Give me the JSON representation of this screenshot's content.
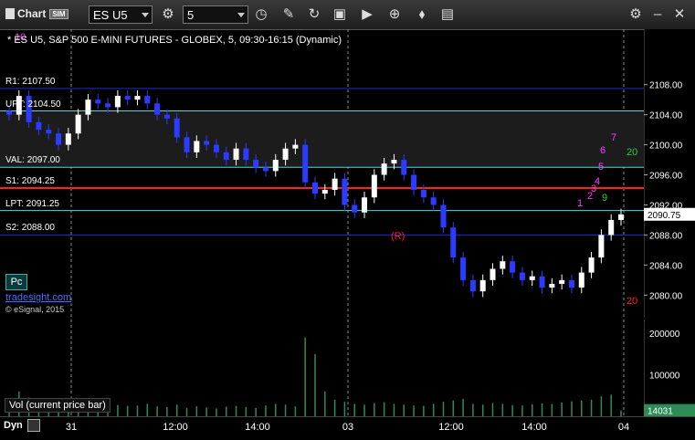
{
  "toolbar": {
    "app_name": "Chart",
    "app_badge": "SIM",
    "symbol": "ES U5",
    "interval": "5"
  },
  "chart_header": {
    "title": "* ES U5, S&P 500 E-MINI FUTURES - GLOBEX, 5, 09:30-16:15 (Dynamic)"
  },
  "levels": [
    {
      "label": "R1: 2107.50",
      "price": 2107.5,
      "color": "#1e2bd6"
    },
    {
      "label": "UPT: 2104.50",
      "price": 2104.5,
      "color": "#40e0e0"
    },
    {
      "label": "VAL: 2097.00",
      "price": 2097.0,
      "color": "#40e0e0"
    },
    {
      "label": "S1: 2094.25",
      "price": 2094.25,
      "color": "#ff2020"
    },
    {
      "label": "LPT: 2091.25",
      "price": 2091.25,
      "color": "#40e0e0"
    },
    {
      "label": "S2: 2088.00",
      "price": 2088.0,
      "color": "#1e2bd6"
    }
  ],
  "chart_data": {
    "type": "candlestick",
    "price_axis_ticks": [
      2108,
      2104,
      2100,
      2096,
      2092,
      2088,
      2084,
      2080
    ],
    "ylim": [
      2077,
      2111
    ],
    "last_price": "2090.75",
    "close_prices": [
      2104.0,
      2106.5,
      2103.0,
      2102.0,
      2101.5,
      2100.0,
      2101.5,
      2104.0,
      2106.0,
      2105.5,
      2105.0,
      2106.5,
      2106.0,
      2106.5,
      2105.5,
      2104.0,
      2103.5,
      2101.0,
      2099.0,
      2100.5,
      2100.0,
      2099.0,
      2098.0,
      2099.5,
      2098.0,
      2097.0,
      2096.5,
      2098.0,
      2099.5,
      2100.0,
      2095.0,
      2093.5,
      2094.0,
      2095.5,
      2092.0,
      2091.0,
      2093.0,
      2096.0,
      2097.5,
      2098.0,
      2096.0,
      2094.0,
      2093.0,
      2092.0,
      2089.0,
      2085.0,
      2082.0,
      2080.5,
      2082.0,
      2083.5,
      2084.5,
      2083.0,
      2082.0,
      2082.5,
      2081.0,
      2081.5,
      2082.0,
      2081.0,
      2083.0,
      2085.0,
      2088.0,
      2090.0,
      2090.75
    ],
    "volume_axis_ticks": [
      "200000",
      "100000"
    ],
    "volume_ylim": [
      0,
      220000
    ],
    "last_volume": "14031",
    "volumes": [
      18000,
      60000,
      45000,
      30000,
      25000,
      28000,
      22000,
      40000,
      35000,
      28000,
      32000,
      27000,
      25000,
      26000,
      30000,
      24000,
      22000,
      28000,
      20000,
      24000,
      21000,
      19000,
      23000,
      25000,
      22000,
      20000,
      26000,
      30000,
      28000,
      24000,
      190000,
      150000,
      60000,
      40000,
      35000,
      30000,
      28000,
      32000,
      34000,
      30000,
      28000,
      26000,
      25000,
      30000,
      35000,
      38000,
      42000,
      30000,
      28000,
      32000,
      30000,
      27000,
      26000,
      29000,
      31000,
      30000,
      33000,
      36000,
      38000,
      40000,
      48000,
      52000,
      14031
    ],
    "x_ticks": [
      "31",
      "12:00",
      "14:00",
      "03",
      "12:00",
      "14:00",
      "04"
    ],
    "annotations": [
      "10",
      "20",
      "20",
      "(R)",
      "1",
      "2",
      "3",
      "4",
      "5",
      "6",
      "7",
      "9"
    ]
  },
  "colors": {
    "bull": "#ffffff",
    "bear": "#2b3bff",
    "volume": "#2e8b57"
  },
  "footer": {
    "pc_button": "Pc",
    "website": "tradesight.com",
    "copyright": "© eSignal, 2015",
    "volume_label": "Vol (current price bar)",
    "dyn_label": "Dyn"
  }
}
